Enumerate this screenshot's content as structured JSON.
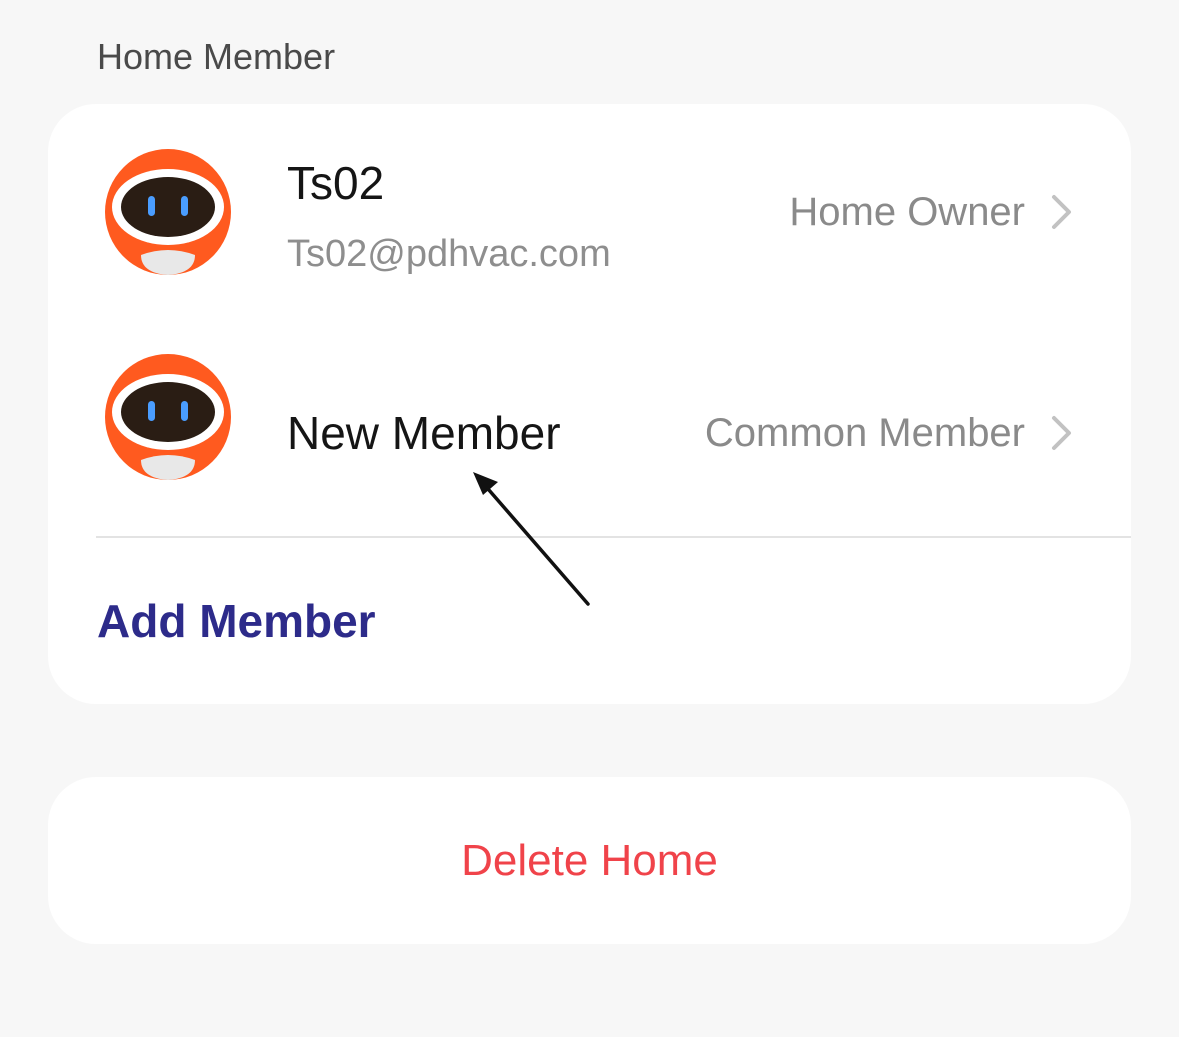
{
  "section": {
    "title": "Home Member"
  },
  "members": [
    {
      "name": "Ts02",
      "email": "Ts02@pdhvac.com",
      "role": "Home Owner",
      "avatar_icon": "robot-avatar-icon"
    },
    {
      "name": "New Member",
      "role": "Common Member",
      "avatar_icon": "robot-avatar-icon"
    }
  ],
  "actions": {
    "add_member_label": "Add Member",
    "delete_home_label": "Delete Home"
  },
  "colors": {
    "background": "#f7f7f7",
    "card": "#ffffff",
    "add_member": "#2d2b8a",
    "delete_home": "#f0434a",
    "avatar_orange": "#ff5a1f",
    "secondary_text": "#8a8a8a"
  },
  "icons": {
    "row_chevron": "chevron-right-icon",
    "annotation": "arrow-pointer-icon"
  }
}
